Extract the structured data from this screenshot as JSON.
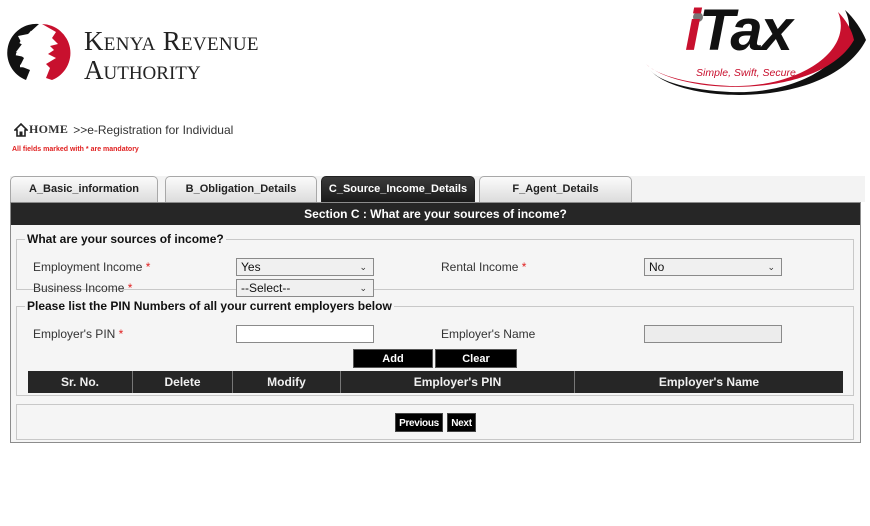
{
  "header": {
    "kra_logo": {
      "line1": "Kenya Revenue",
      "line2": "Authority"
    },
    "itax_logo": {
      "prefix": "i",
      "word": "Tax",
      "tagline": "Simple, Swift, Secure"
    }
  },
  "breadcrumb": {
    "home_label": "HOME",
    "path": ">>e-Registration for Individual"
  },
  "mandatory_note": "All fields marked with * are mandatory",
  "tabs": [
    {
      "label": "A_Basic_information",
      "active": false
    },
    {
      "label": "B_Obligation_Details",
      "active": false
    },
    {
      "label": "C_Source_Income_Details",
      "active": true
    },
    {
      "label": "F_Agent_Details",
      "active": false
    }
  ],
  "section": {
    "title": "Section C : What are your sources of income?"
  },
  "income_sources": {
    "legend": "What are your sources of income?",
    "required_marker": "*",
    "employment": {
      "label": "Employment Income",
      "value": "Yes"
    },
    "business": {
      "label": "Business Income",
      "value": "--Select--"
    },
    "rental": {
      "label": "Rental Income",
      "value": "No"
    }
  },
  "employers": {
    "legend": "Please list the PIN Numbers of all your current employers below",
    "pin": {
      "label": "Employer's PIN",
      "value": ""
    },
    "name": {
      "label": "Employer's Name",
      "value": ""
    },
    "add_label": "Add",
    "clear_label": "Clear",
    "columns": [
      "Sr. No.",
      "Delete",
      "Modify",
      "Employer's PIN",
      "Employer's Name"
    ]
  },
  "navigation": {
    "previous_label": "Previous",
    "next_label": "Next"
  },
  "colors": {
    "brand_red": "#c8102e",
    "header_dark": "#262626",
    "required_red": "#e02020"
  }
}
